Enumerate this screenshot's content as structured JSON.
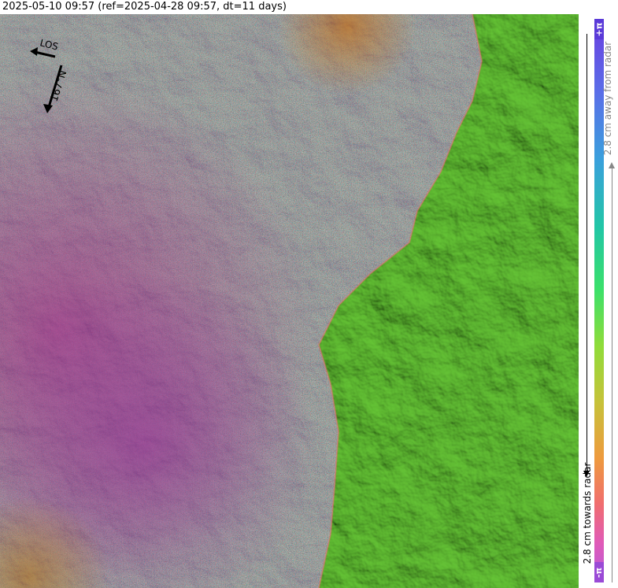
{
  "header": {
    "title": "2025-05-10 09:57 (ref=2025-04-28 09:57, dt=11 days)"
  },
  "compass": {
    "los_label": "LOS",
    "heading_label": "167°N",
    "arrow_color": "#000000"
  },
  "colorbar": {
    "top_label": "+π",
    "bottom_label": "-π",
    "towards_label": "2.8 cm towards radar",
    "away_label": "2.8 cm away from radar"
  },
  "palette": {
    "land_green": "#6fcf3a",
    "noise_purple": "#b45ab4",
    "noise_magenta": "#d24cb8",
    "noise_orange": "#e88a4a"
  }
}
